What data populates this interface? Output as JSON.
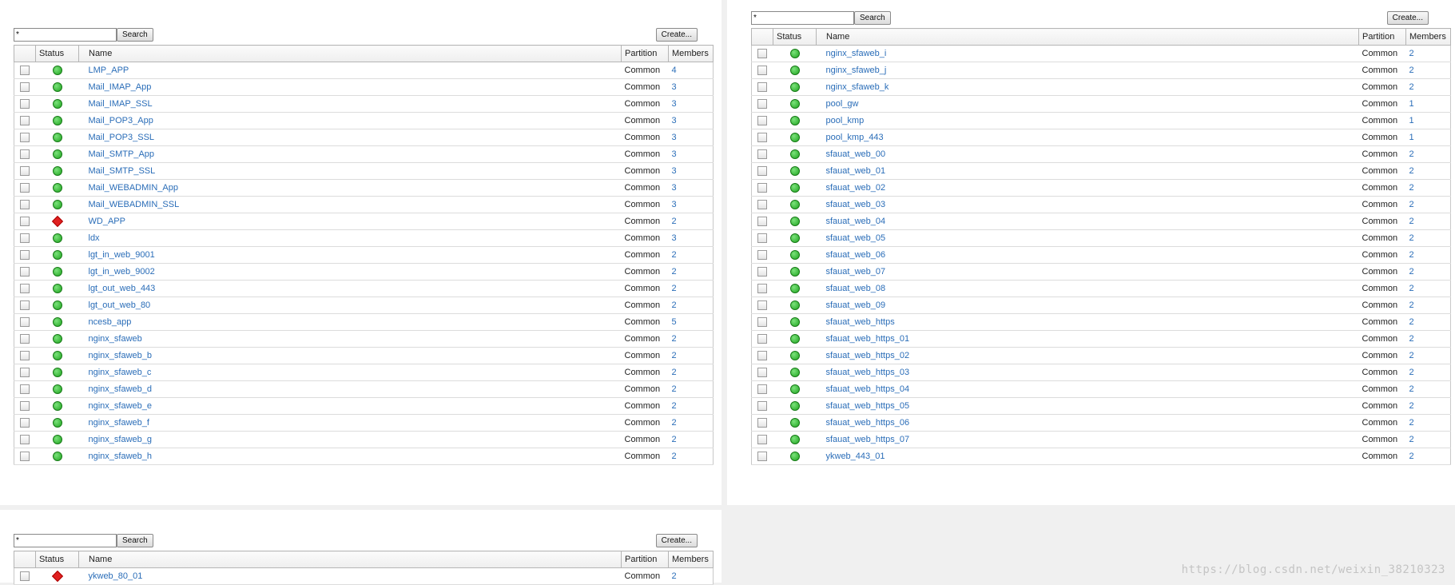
{
  "columns": {
    "status": "Status",
    "name": "Name",
    "partition": "Partition",
    "members": "Members"
  },
  "search_value": "*",
  "search_label": "Search",
  "create_label": "Create...",
  "status_colors": {
    "available": "#22aa22",
    "offline": "#e02020"
  },
  "panel_a_rows": [
    {
      "name": "LMP_APP",
      "status": "available",
      "partition": "Common",
      "members": "4"
    },
    {
      "name": "Mail_IMAP_App",
      "status": "available",
      "partition": "Common",
      "members": "3"
    },
    {
      "name": "Mail_IMAP_SSL",
      "status": "available",
      "partition": "Common",
      "members": "3"
    },
    {
      "name": "Mail_POP3_App",
      "status": "available",
      "partition": "Common",
      "members": "3"
    },
    {
      "name": "Mail_POP3_SSL",
      "status": "available",
      "partition": "Common",
      "members": "3"
    },
    {
      "name": "Mail_SMTP_App",
      "status": "available",
      "partition": "Common",
      "members": "3"
    },
    {
      "name": "Mail_SMTP_SSL",
      "status": "available",
      "partition": "Common",
      "members": "3"
    },
    {
      "name": "Mail_WEBADMIN_App",
      "status": "available",
      "partition": "Common",
      "members": "3"
    },
    {
      "name": "Mail_WEBADMIN_SSL",
      "status": "available",
      "partition": "Common",
      "members": "3"
    },
    {
      "name": "WD_APP",
      "status": "offline",
      "partition": "Common",
      "members": "2"
    },
    {
      "name": "ldx",
      "status": "available",
      "partition": "Common",
      "members": "3"
    },
    {
      "name": "lgt_in_web_9001",
      "status": "available",
      "partition": "Common",
      "members": "2"
    },
    {
      "name": "lgt_in_web_9002",
      "status": "available",
      "partition": "Common",
      "members": "2"
    },
    {
      "name": "lgt_out_web_443",
      "status": "available",
      "partition": "Common",
      "members": "2"
    },
    {
      "name": "lgt_out_web_80",
      "status": "available",
      "partition": "Common",
      "members": "2"
    },
    {
      "name": "ncesb_app",
      "status": "available",
      "partition": "Common",
      "members": "5"
    },
    {
      "name": "nginx_sfaweb",
      "status": "available",
      "partition": "Common",
      "members": "2"
    },
    {
      "name": "nginx_sfaweb_b",
      "status": "available",
      "partition": "Common",
      "members": "2"
    },
    {
      "name": "nginx_sfaweb_c",
      "status": "available",
      "partition": "Common",
      "members": "2"
    },
    {
      "name": "nginx_sfaweb_d",
      "status": "available",
      "partition": "Common",
      "members": "2"
    },
    {
      "name": "nginx_sfaweb_e",
      "status": "available",
      "partition": "Common",
      "members": "2"
    },
    {
      "name": "nginx_sfaweb_f",
      "status": "available",
      "partition": "Common",
      "members": "2"
    },
    {
      "name": "nginx_sfaweb_g",
      "status": "available",
      "partition": "Common",
      "members": "2"
    },
    {
      "name": "nginx_sfaweb_h",
      "status": "available",
      "partition": "Common",
      "members": "2"
    }
  ],
  "panel_b_rows": [
    {
      "name": "nginx_sfaweb_i",
      "status": "available",
      "partition": "Common",
      "members": "2"
    },
    {
      "name": "nginx_sfaweb_j",
      "status": "available",
      "partition": "Common",
      "members": "2"
    },
    {
      "name": "nginx_sfaweb_k",
      "status": "available",
      "partition": "Common",
      "members": "2"
    },
    {
      "name": "pool_gw",
      "status": "available",
      "partition": "Common",
      "members": "1"
    },
    {
      "name": "pool_kmp",
      "status": "available",
      "partition": "Common",
      "members": "1"
    },
    {
      "name": "pool_kmp_443",
      "status": "available",
      "partition": "Common",
      "members": "1"
    },
    {
      "name": "sfauat_web_00",
      "status": "available",
      "partition": "Common",
      "members": "2"
    },
    {
      "name": "sfauat_web_01",
      "status": "available",
      "partition": "Common",
      "members": "2"
    },
    {
      "name": "sfauat_web_02",
      "status": "available",
      "partition": "Common",
      "members": "2"
    },
    {
      "name": "sfauat_web_03",
      "status": "available",
      "partition": "Common",
      "members": "2"
    },
    {
      "name": "sfauat_web_04",
      "status": "available",
      "partition": "Common",
      "members": "2"
    },
    {
      "name": "sfauat_web_05",
      "status": "available",
      "partition": "Common",
      "members": "2"
    },
    {
      "name": "sfauat_web_06",
      "status": "available",
      "partition": "Common",
      "members": "2"
    },
    {
      "name": "sfauat_web_07",
      "status": "available",
      "partition": "Common",
      "members": "2"
    },
    {
      "name": "sfauat_web_08",
      "status": "available",
      "partition": "Common",
      "members": "2"
    },
    {
      "name": "sfauat_web_09",
      "status": "available",
      "partition": "Common",
      "members": "2"
    },
    {
      "name": "sfauat_web_https",
      "status": "available",
      "partition": "Common",
      "members": "2"
    },
    {
      "name": "sfauat_web_https_01",
      "status": "available",
      "partition": "Common",
      "members": "2"
    },
    {
      "name": "sfauat_web_https_02",
      "status": "available",
      "partition": "Common",
      "members": "2"
    },
    {
      "name": "sfauat_web_https_03",
      "status": "available",
      "partition": "Common",
      "members": "2"
    },
    {
      "name": "sfauat_web_https_04",
      "status": "available",
      "partition": "Common",
      "members": "2"
    },
    {
      "name": "sfauat_web_https_05",
      "status": "available",
      "partition": "Common",
      "members": "2"
    },
    {
      "name": "sfauat_web_https_06",
      "status": "available",
      "partition": "Common",
      "members": "2"
    },
    {
      "name": "sfauat_web_https_07",
      "status": "available",
      "partition": "Common",
      "members": "2"
    },
    {
      "name": "ykweb_443_01",
      "status": "available",
      "partition": "Common",
      "members": "2"
    }
  ],
  "panel_c_rows": [
    {
      "name": "ykweb_80_01",
      "status": "offline",
      "partition": "Common",
      "members": "2"
    }
  ],
  "watermark": "https://blog.csdn.net/weixin_38210323"
}
